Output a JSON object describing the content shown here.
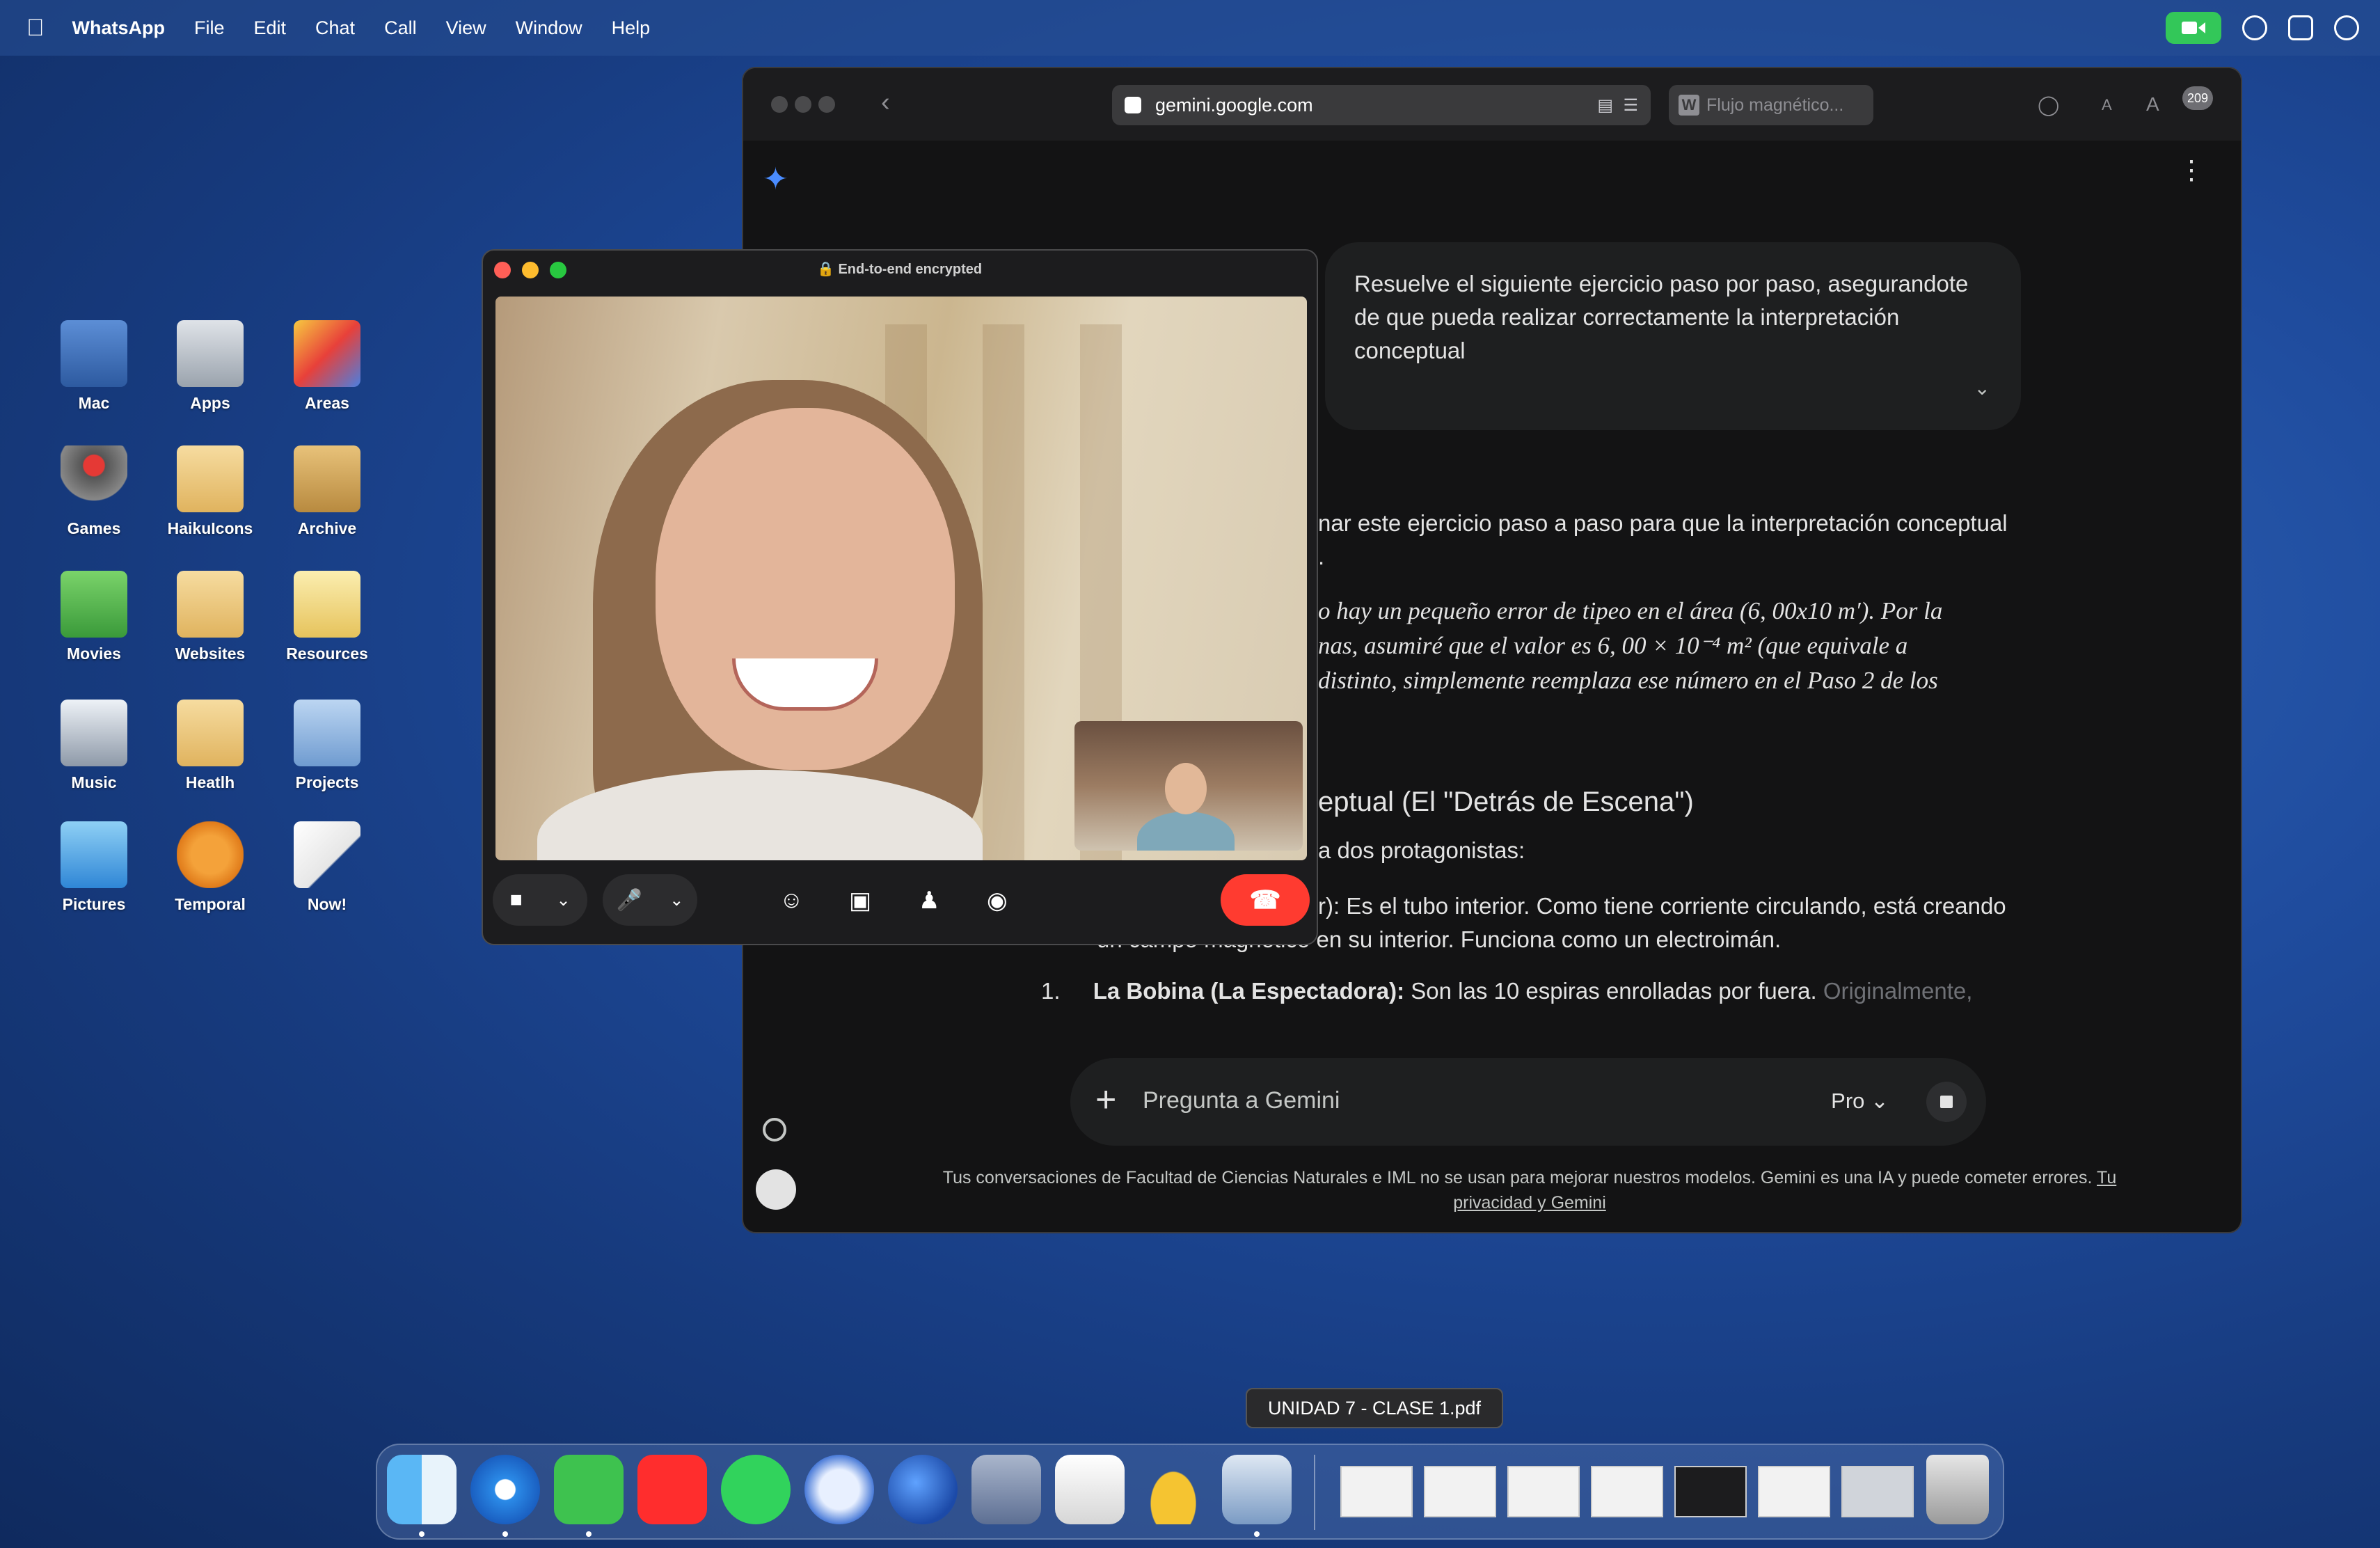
{
  "menubar": {
    "app_name": "WhatsApp",
    "items": [
      "File",
      "Edit",
      "Chat",
      "Call",
      "View",
      "Window",
      "Help"
    ]
  },
  "desktop_icons": [
    {
      "label": "Mac"
    },
    {
      "label": "Apps"
    },
    {
      "label": "Areas"
    },
    {
      "label": "Games"
    },
    {
      "label": "HaikuIcons"
    },
    {
      "label": "Archive"
    },
    {
      "label": "Movies"
    },
    {
      "label": "Websites"
    },
    {
      "label": "Resources"
    },
    {
      "label": "Music"
    },
    {
      "label": "Heatlh"
    },
    {
      "label": "Projects"
    },
    {
      "label": "Pictures"
    },
    {
      "label": "Temporal"
    },
    {
      "label": "Now!"
    }
  ],
  "browser": {
    "url": "gemini.google.com",
    "second_tab": "Flujo magnético...",
    "tab_count_badge": "209",
    "prompt": "Resuelve el siguiente ejercicio paso por paso, asegurandote de que pueda realizar correctamente la interpretación conceptual",
    "response": {
      "line1": "nar este ejercicio paso a paso para que la interpretación conceptual",
      "line1b": ".",
      "note1": "o hay un pequeño error de tipeo en el área (6, 00x10 m′). Por la",
      "note2": "nas, asumiré que el valor es 6, 00 × 10⁻⁴ m² (que equivale a",
      "note3": "distinto, simplemente reemplaza ese número en el Paso 2 de los",
      "heading": "eptual (El \"Detrás de Escena\")",
      "intro": "a dos protagonistas:",
      "item1a": "r): Es el tubo interior. Como tiene corriente circulando, está creando",
      "item1b": "un campo magnético en su interior. Funciona como un electroimán.",
      "item2_number": "1.",
      "item2_bold": "La Bobina (La Espectadora):",
      "item2_text": "Son las 10 espiras enrolladas por fuera.",
      "item2_faded": "Originalmente,"
    },
    "input_placeholder": "Pregunta a Gemini",
    "model": "Pro",
    "disclaimer": "Tus conversaciones de Facultad de Ciencias Naturales e IML no se usan para mejorar nuestros modelos. Gemini es una IA y puede cometer errores.",
    "privacy_link": "Tu privacidad y Gemini"
  },
  "call": {
    "encryption_label": "End-to-end encrypted"
  },
  "dock": {
    "tooltip": "UNIDAD 7 - CLASE 1.pdf",
    "apps": [
      "finder",
      "safari",
      "whatsapp",
      "youtube",
      "spotify",
      "compass",
      "google-earth",
      "layers",
      "textedit",
      "pineapple",
      "preview"
    ]
  },
  "colors": {
    "accent_green": "#33c759",
    "end_call_red": "#ff3b30",
    "gemini_bg": "#131314"
  }
}
